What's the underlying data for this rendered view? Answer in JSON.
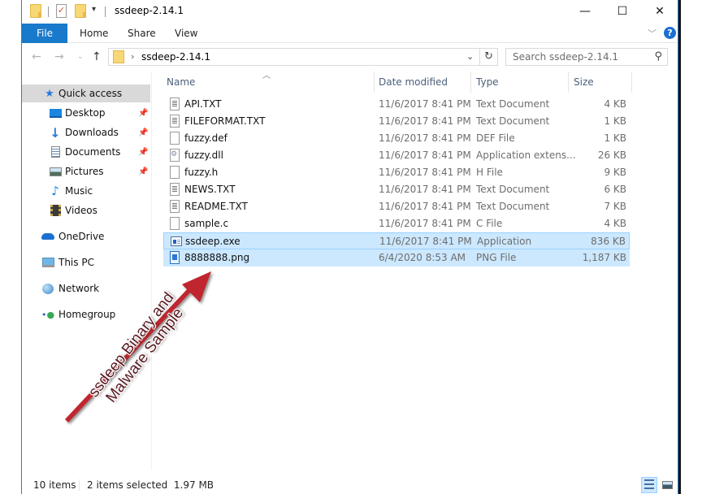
{
  "window": {
    "title": "ssdeep-2.14.1",
    "controls": {
      "minimize": "—",
      "maximize": "☐",
      "close": "✕"
    }
  },
  "ribbon": {
    "tabs": [
      {
        "label": "File",
        "active": true
      },
      {
        "label": "Home"
      },
      {
        "label": "Share"
      },
      {
        "label": "View"
      }
    ],
    "help": "?",
    "accent_color": "#1979ca"
  },
  "address": {
    "path": "ssdeep-2.14.1",
    "search_placeholder": "Search ssdeep-2.14.1"
  },
  "navigation": {
    "items": [
      {
        "label": "Quick access",
        "icon": "star-icon",
        "selected": true
      },
      {
        "label": "Desktop",
        "icon": "desktop-icon",
        "pinned": true
      },
      {
        "label": "Downloads",
        "icon": "download-icon",
        "pinned": true
      },
      {
        "label": "Documents",
        "icon": "documents-icon",
        "pinned": true
      },
      {
        "label": "Pictures",
        "icon": "pictures-icon",
        "pinned": true
      },
      {
        "label": "Music",
        "icon": "music-icon"
      },
      {
        "label": "Videos",
        "icon": "videos-icon"
      },
      {
        "label": "OneDrive",
        "icon": "cloud-icon"
      },
      {
        "label": "This PC",
        "icon": "computer-icon"
      },
      {
        "label": "Network",
        "icon": "network-icon"
      },
      {
        "label": "Homegroup",
        "icon": "homegroup-icon"
      }
    ]
  },
  "file_list": {
    "columns": [
      "Name",
      "Date modified",
      "Type",
      "Size"
    ],
    "rows": [
      {
        "name": "API.TXT",
        "date": "11/6/2017 8:41 PM",
        "type": "Text Document",
        "size": "4 KB",
        "icon": "txt"
      },
      {
        "name": "FILEFORMAT.TXT",
        "date": "11/6/2017 8:41 PM",
        "type": "Text Document",
        "size": "1 KB",
        "icon": "txt"
      },
      {
        "name": "fuzzy.def",
        "date": "11/6/2017 8:41 PM",
        "type": "DEF File",
        "size": "1 KB",
        "icon": "blank"
      },
      {
        "name": "fuzzy.dll",
        "date": "11/6/2017 8:41 PM",
        "type": "Application extens...",
        "size": "26 KB",
        "icon": "dll"
      },
      {
        "name": "fuzzy.h",
        "date": "11/6/2017 8:41 PM",
        "type": "H File",
        "size": "9 KB",
        "icon": "blank"
      },
      {
        "name": "NEWS.TXT",
        "date": "11/6/2017 8:41 PM",
        "type": "Text Document",
        "size": "6 KB",
        "icon": "txt"
      },
      {
        "name": "README.TXT",
        "date": "11/6/2017 8:41 PM",
        "type": "Text Document",
        "size": "7 KB",
        "icon": "txt"
      },
      {
        "name": "sample.c",
        "date": "11/6/2017 8:41 PM",
        "type": "C File",
        "size": "4 KB",
        "icon": "blank"
      },
      {
        "name": "ssdeep.exe",
        "date": "11/6/2017 8:41 PM",
        "type": "Application",
        "size": "836 KB",
        "icon": "exe",
        "selected": true
      },
      {
        "name": "8888888.png",
        "date": "6/4/2020 8:53 AM",
        "type": "PNG File",
        "size": "1,187 KB",
        "icon": "png",
        "selected": true
      }
    ],
    "selection_color": "#cce8ff"
  },
  "status": {
    "item_count": "10 items",
    "selection": "2 items selected  1.97 MB"
  },
  "annotation": {
    "line1": "ssdeep Binary and",
    "line2": "Malware Sample",
    "arrow_color": "#c0262d"
  }
}
